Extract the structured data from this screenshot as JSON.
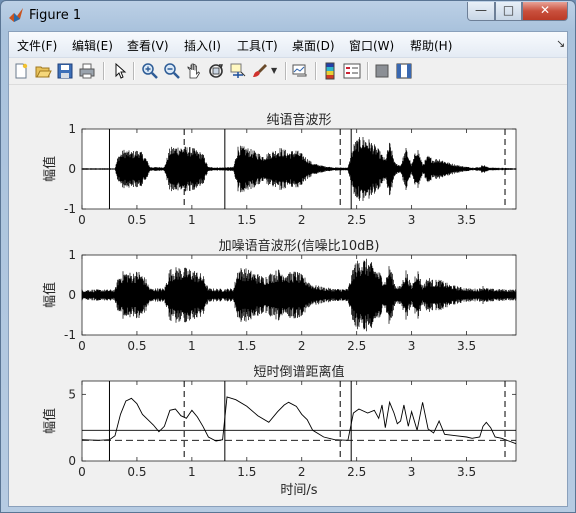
{
  "window": {
    "title": "Figure 1",
    "minimize_glyph": "—",
    "maximize_glyph": "□",
    "close_glyph": "✕"
  },
  "menu": [
    "文件(F)",
    "编辑(E)",
    "查看(V)",
    "插入(I)",
    "工具(T)",
    "桌面(D)",
    "窗口(W)",
    "帮助(H)"
  ],
  "menu_overflow_glyph": "↘",
  "toolbar": [
    "new-figure-icon",
    "open-file-icon",
    "save-icon",
    "print-icon",
    "pointer-icon",
    "zoom-in-icon",
    "zoom-out-icon",
    "pan-icon",
    "rotate-3d-icon",
    "data-cursor-icon",
    "brush-icon",
    "brush-dropdown-icon",
    "link-plot-icon",
    "colorbar-icon",
    "legend-icon",
    "hide-plot-tools-icon",
    "show-plot-tools-icon"
  ],
  "xticks": [
    "0",
    "0.5",
    "1",
    "1.5",
    "2",
    "2.5",
    "3",
    "3.5"
  ],
  "chart_data": [
    {
      "type": "line",
      "title": "纯语音波形",
      "ylabel": "幅值",
      "xlim": [
        0,
        3.95
      ],
      "ylim": [
        -1,
        1
      ],
      "yticks": [
        "1",
        "0",
        "-1"
      ],
      "segments": [
        [
          0.25,
          0.93
        ],
        [
          1.3,
          2.35
        ],
        [
          2.45,
          3.85
        ]
      ],
      "series": [
        {
          "envelope": [
            [
              0.0,
              0.02
            ],
            [
              0.3,
              0.02
            ],
            [
              0.33,
              0.35
            ],
            [
              0.38,
              0.5
            ],
            [
              0.45,
              0.45
            ],
            [
              0.52,
              0.5
            ],
            [
              0.58,
              0.3
            ],
            [
              0.62,
              0.05
            ],
            [
              0.75,
              0.05
            ],
            [
              0.8,
              0.55
            ],
            [
              0.88,
              0.6
            ],
            [
              1.0,
              0.55
            ],
            [
              1.1,
              0.4
            ],
            [
              1.15,
              0.05
            ],
            [
              1.25,
              0.04
            ],
            [
              1.38,
              0.05
            ],
            [
              1.42,
              0.6
            ],
            [
              1.5,
              0.55
            ],
            [
              1.58,
              0.45
            ],
            [
              1.65,
              0.35
            ],
            [
              1.72,
              0.45
            ],
            [
              1.8,
              0.55
            ],
            [
              1.88,
              0.45
            ],
            [
              1.95,
              0.5
            ],
            [
              2.02,
              0.35
            ],
            [
              2.1,
              0.15
            ],
            [
              2.2,
              0.08
            ],
            [
              2.3,
              0.04
            ],
            [
              2.42,
              0.04
            ],
            [
              2.48,
              0.7
            ],
            [
              2.55,
              0.85
            ],
            [
              2.62,
              0.75
            ],
            [
              2.7,
              0.5
            ],
            [
              2.76,
              0.25
            ],
            [
              2.8,
              0.7
            ],
            [
              2.85,
              0.15
            ],
            [
              2.9,
              0.1
            ],
            [
              2.95,
              0.55
            ],
            [
              3.0,
              0.1
            ],
            [
              3.05,
              0.6
            ],
            [
              3.1,
              0.12
            ],
            [
              3.15,
              0.35
            ],
            [
              3.2,
              0.25
            ],
            [
              3.25,
              0.28
            ],
            [
              3.35,
              0.15
            ],
            [
              3.45,
              0.08
            ],
            [
              3.55,
              0.04
            ],
            [
              3.62,
              0.05
            ],
            [
              3.65,
              0.12
            ],
            [
              3.7,
              0.04
            ],
            [
              3.95,
              0.02
            ]
          ]
        }
      ]
    },
    {
      "type": "line",
      "title": "加噪语音波形(信噪比10dB)",
      "ylabel": "幅值",
      "xlim": [
        0,
        3.95
      ],
      "ylim": [
        -1,
        1
      ],
      "yticks": [
        "1",
        "0",
        "-1"
      ],
      "segments": [],
      "series": [
        {
          "noise_level": 0.12
        }
      ]
    },
    {
      "type": "line",
      "title": "短时倒谱距离值",
      "ylabel": "幅值",
      "xlabel": "时间/s",
      "xlim": [
        0,
        3.95
      ],
      "ylim": [
        0,
        6
      ],
      "yticks": [
        "5",
        "0"
      ],
      "thresholds": [
        2.3,
        1.55
      ],
      "segments": [
        [
          0.25,
          0.93
        ],
        [
          1.3,
          2.35
        ],
        [
          2.45,
          3.85
        ]
      ],
      "series": [
        {
          "values": [
            [
              0.0,
              1.6
            ],
            [
              0.15,
              1.55
            ],
            [
              0.25,
              1.6
            ],
            [
              0.3,
              1.9
            ],
            [
              0.35,
              3.5
            ],
            [
              0.4,
              4.5
            ],
            [
              0.45,
              4.7
            ],
            [
              0.5,
              4.3
            ],
            [
              0.55,
              3.5
            ],
            [
              0.6,
              3.1
            ],
            [
              0.65,
              2.7
            ],
            [
              0.7,
              2.2
            ],
            [
              0.75,
              2.6
            ],
            [
              0.8,
              3.8
            ],
            [
              0.85,
              3.9
            ],
            [
              0.9,
              3.4
            ],
            [
              0.95,
              3.2
            ],
            [
              1.0,
              3.8
            ],
            [
              1.05,
              3.3
            ],
            [
              1.1,
              2.6
            ],
            [
              1.15,
              1.8
            ],
            [
              1.22,
              1.5
            ],
            [
              1.28,
              1.6
            ],
            [
              1.32,
              4.8
            ],
            [
              1.4,
              4.6
            ],
            [
              1.5,
              4.1
            ],
            [
              1.6,
              3.4
            ],
            [
              1.7,
              2.9
            ],
            [
              1.78,
              3.7
            ],
            [
              1.84,
              4.2
            ],
            [
              1.88,
              4.4
            ],
            [
              1.95,
              4.1
            ],
            [
              2.0,
              3.5
            ],
            [
              2.05,
              3.1
            ],
            [
              2.1,
              2.3
            ],
            [
              2.2,
              1.8
            ],
            [
              2.3,
              1.6
            ],
            [
              2.42,
              1.55
            ],
            [
              2.47,
              3.6
            ],
            [
              2.52,
              3.9
            ],
            [
              2.6,
              3.6
            ],
            [
              2.66,
              3.8
            ],
            [
              2.7,
              3.2
            ],
            [
              2.73,
              4.2
            ],
            [
              2.76,
              2.5
            ],
            [
              2.8,
              4.4
            ],
            [
              2.84,
              3.6
            ],
            [
              2.87,
              2.8
            ],
            [
              2.9,
              3.0
            ],
            [
              2.93,
              4.2
            ],
            [
              2.97,
              2.6
            ],
            [
              3.0,
              3.7
            ],
            [
              3.05,
              2.3
            ],
            [
              3.1,
              4.4
            ],
            [
              3.15,
              2.4
            ],
            [
              3.2,
              2.1
            ],
            [
              3.25,
              3.0
            ],
            [
              3.3,
              2.0
            ],
            [
              3.4,
              1.9
            ],
            [
              3.5,
              1.8
            ],
            [
              3.55,
              1.7
            ],
            [
              3.62,
              1.8
            ],
            [
              3.65,
              2.6
            ],
            [
              3.68,
              2.9
            ],
            [
              3.72,
              2.5
            ],
            [
              3.76,
              1.8
            ],
            [
              3.82,
              1.7
            ],
            [
              3.95,
              1.3
            ]
          ]
        }
      ]
    }
  ]
}
